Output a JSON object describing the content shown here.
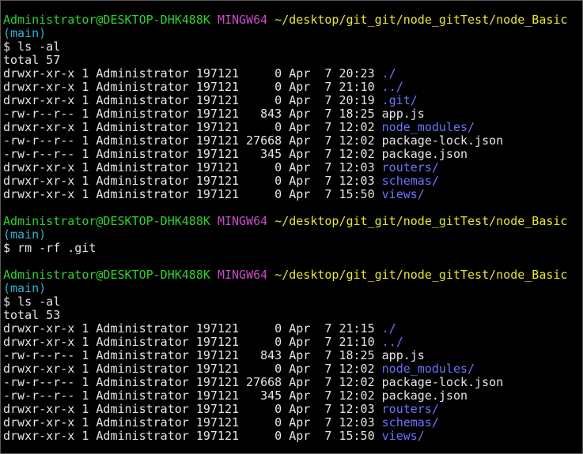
{
  "colors": {
    "background": "#000000",
    "text": "#e5e5e5",
    "user": "#2fd22f",
    "mingw": "#c84bc8",
    "path": "#e6e634",
    "branch": "#2fb3d2",
    "directory": "#6b74ff"
  },
  "prompt": {
    "user_host": "Administrator@DESKTOP-DHK488K",
    "shell": "MINGW64",
    "path": "~/desktop/git_git/node_gitTest/node_Basic",
    "branch": "(main)",
    "symbol": "$"
  },
  "sessions": [
    {
      "show_branch": true,
      "command": "ls -al",
      "output": {
        "total": "total 57",
        "entries": [
          {
            "meta": "drwxr-xr-x 1 Administrator 197121     0 Apr  7 20:23 ",
            "name": "./",
            "is_dir": true
          },
          {
            "meta": "drwxr-xr-x 1 Administrator 197121     0 Apr  7 21:10 ",
            "name": "../",
            "is_dir": true
          },
          {
            "meta": "drwxr-xr-x 1 Administrator 197121     0 Apr  7 20:19 ",
            "name": ".git/",
            "is_dir": true
          },
          {
            "meta": "-rw-r--r-- 1 Administrator 197121   843 Apr  7 18:25 ",
            "name": "app.js",
            "is_dir": false
          },
          {
            "meta": "drwxr-xr-x 1 Administrator 197121     0 Apr  7 12:02 ",
            "name": "node_modules/",
            "is_dir": true
          },
          {
            "meta": "-rw-r--r-- 1 Administrator 197121 27668 Apr  7 12:02 ",
            "name": "package-lock.json",
            "is_dir": false
          },
          {
            "meta": "-rw-r--r-- 1 Administrator 197121   345 Apr  7 12:02 ",
            "name": "package.json",
            "is_dir": false
          },
          {
            "meta": "drwxr-xr-x 1 Administrator 197121     0 Apr  7 12:03 ",
            "name": "routers/",
            "is_dir": true
          },
          {
            "meta": "drwxr-xr-x 1 Administrator 197121     0 Apr  7 12:03 ",
            "name": "schemas/",
            "is_dir": true
          },
          {
            "meta": "drwxr-xr-x 1 Administrator 197121     0 Apr  7 15:50 ",
            "name": "views/",
            "is_dir": true
          }
        ]
      }
    },
    {
      "show_branch": true,
      "command": "rm -rf .git",
      "output": null
    },
    {
      "show_branch": true,
      "command": "ls -al",
      "output": {
        "total": "total 53",
        "entries": [
          {
            "meta": "drwxr-xr-x 1 Administrator 197121     0 Apr  7 21:15 ",
            "name": "./",
            "is_dir": true
          },
          {
            "meta": "drwxr-xr-x 1 Administrator 197121     0 Apr  7 21:10 ",
            "name": "../",
            "is_dir": true
          },
          {
            "meta": "-rw-r--r-- 1 Administrator 197121   843 Apr  7 18:25 ",
            "name": "app.js",
            "is_dir": false
          },
          {
            "meta": "drwxr-xr-x 1 Administrator 197121     0 Apr  7 12:02 ",
            "name": "node_modules/",
            "is_dir": true
          },
          {
            "meta": "-rw-r--r-- 1 Administrator 197121 27668 Apr  7 12:02 ",
            "name": "package-lock.json",
            "is_dir": false
          },
          {
            "meta": "-rw-r--r-- 1 Administrator 197121   345 Apr  7 12:02 ",
            "name": "package.json",
            "is_dir": false
          },
          {
            "meta": "drwxr-xr-x 1 Administrator 197121     0 Apr  7 12:03 ",
            "name": "routers/",
            "is_dir": true
          },
          {
            "meta": "drwxr-xr-x 1 Administrator 197121     0 Apr  7 12:03 ",
            "name": "schemas/",
            "is_dir": true
          },
          {
            "meta": "drwxr-xr-x 1 Administrator 197121     0 Apr  7 15:50 ",
            "name": "views/",
            "is_dir": true
          }
        ]
      }
    }
  ]
}
